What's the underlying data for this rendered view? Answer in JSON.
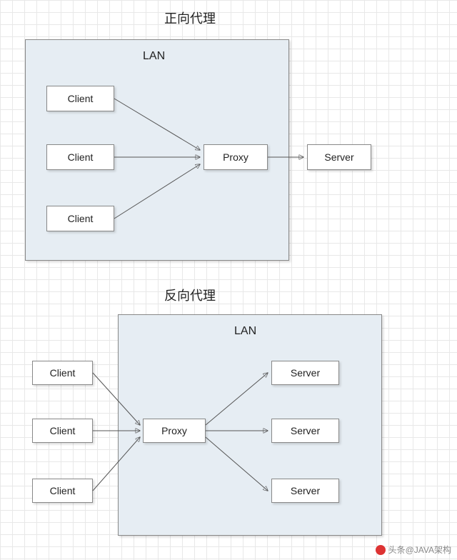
{
  "forward": {
    "title": "正向代理",
    "lan_label": "LAN",
    "clients": [
      "Client",
      "Client",
      "Client"
    ],
    "proxy": "Proxy",
    "server": "Server"
  },
  "reverse": {
    "title": "反向代理",
    "lan_label": "LAN",
    "clients": [
      "Client",
      "Client",
      "Client"
    ],
    "proxy": "Proxy",
    "servers": [
      "Server",
      "Server",
      "Server"
    ]
  },
  "watermark": "头条@JAVA架构"
}
